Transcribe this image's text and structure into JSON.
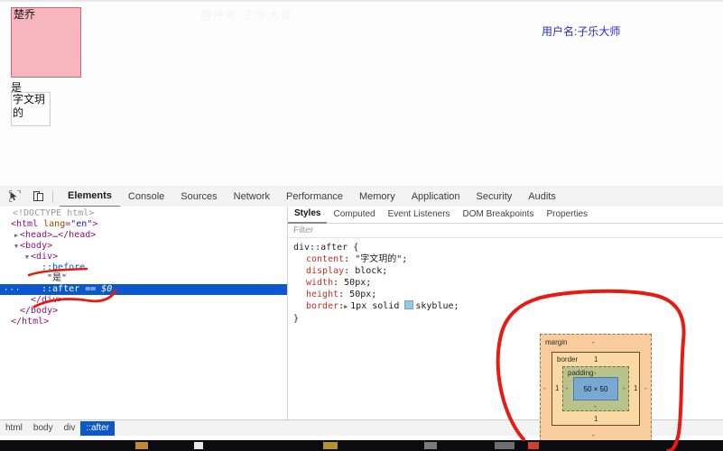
{
  "page": {
    "watermark": "用户名:子乐大师",
    "before_box_text": "楚乔",
    "mid_text": "是",
    "after_box_text": "字文玥的",
    "username": "用户名:子乐大师",
    "pink_color": "#f7b6bd",
    "pink_border_color": "#c86a74",
    "username_color": "#2a2ad0"
  },
  "devtools": {
    "inspect_icon": "inspect-cursor-icon",
    "device_icon": "device-toolbar-icon",
    "tabs": [
      {
        "label": "Elements",
        "active": true
      },
      {
        "label": "Console",
        "active": false
      },
      {
        "label": "Sources",
        "active": false
      },
      {
        "label": "Network",
        "active": false
      },
      {
        "label": "Performance",
        "active": false
      },
      {
        "label": "Memory",
        "active": false
      },
      {
        "label": "Application",
        "active": false
      },
      {
        "label": "Security",
        "active": false
      },
      {
        "label": "Audits",
        "active": false
      }
    ],
    "dom": {
      "doctype": "<!DOCTYPE html>",
      "html_open_tag": "<html",
      "html_attr_name": "lang",
      "html_attr_value": "\"en\"",
      "html_close_bracket": ">",
      "head_collapsed": "<head>…</head>",
      "body_open": "<body>",
      "div_open": "<div>",
      "before_pseudo": "::before",
      "before_text": "\"是\"",
      "after_pseudo": "::after",
      "after_selected_marker": "== $0",
      "div_close": "</div>",
      "body_close": "</body>",
      "html_close": "</html>"
    },
    "styles": {
      "tabs": [
        {
          "label": "Styles",
          "active": true
        },
        {
          "label": "Computed",
          "active": false
        },
        {
          "label": "Event Listeners",
          "active": false
        },
        {
          "label": "DOM Breakpoints",
          "active": false
        },
        {
          "label": "Properties",
          "active": false
        }
      ],
      "filter_placeholder": "Filter",
      "rule_selector": "div::after {",
      "rule_close": "}",
      "declarations": [
        {
          "prop": "content",
          "value": "\"字文玥的\";",
          "expandable": false,
          "swatch": null
        },
        {
          "prop": "display",
          "value": "block;",
          "expandable": false,
          "swatch": null
        },
        {
          "prop": "width",
          "value": "50px;",
          "expandable": false,
          "swatch": null
        },
        {
          "prop": "height",
          "value": "50px;",
          "expandable": false,
          "swatch": null
        },
        {
          "prop": "border",
          "value": "1px solid skyblue;",
          "expandable": true,
          "swatch": "#87ceeb"
        }
      ]
    },
    "box_model": {
      "margin_label": "margin",
      "margin_top": "-",
      "margin_right": "-",
      "margin_bottom": "-",
      "margin_left": "-",
      "border_label": "border",
      "border_top": "1",
      "border_right": "1",
      "border_bottom": "1",
      "border_left": "1",
      "padding_label": "padding",
      "padding_top": "-",
      "padding_right": "-",
      "padding_bottom": "-",
      "padding_left": "-",
      "content_size": "50 × 50"
    },
    "breadcrumb": [
      {
        "label": "html",
        "selected": false
      },
      {
        "label": "body",
        "selected": false
      },
      {
        "label": "div",
        "selected": false
      },
      {
        "label": "::after",
        "selected": true
      }
    ]
  },
  "annotations": {
    "color": "#e81a12",
    "marks": [
      "underline-before-row",
      "underline-after-row",
      "circle-box-model"
    ]
  }
}
